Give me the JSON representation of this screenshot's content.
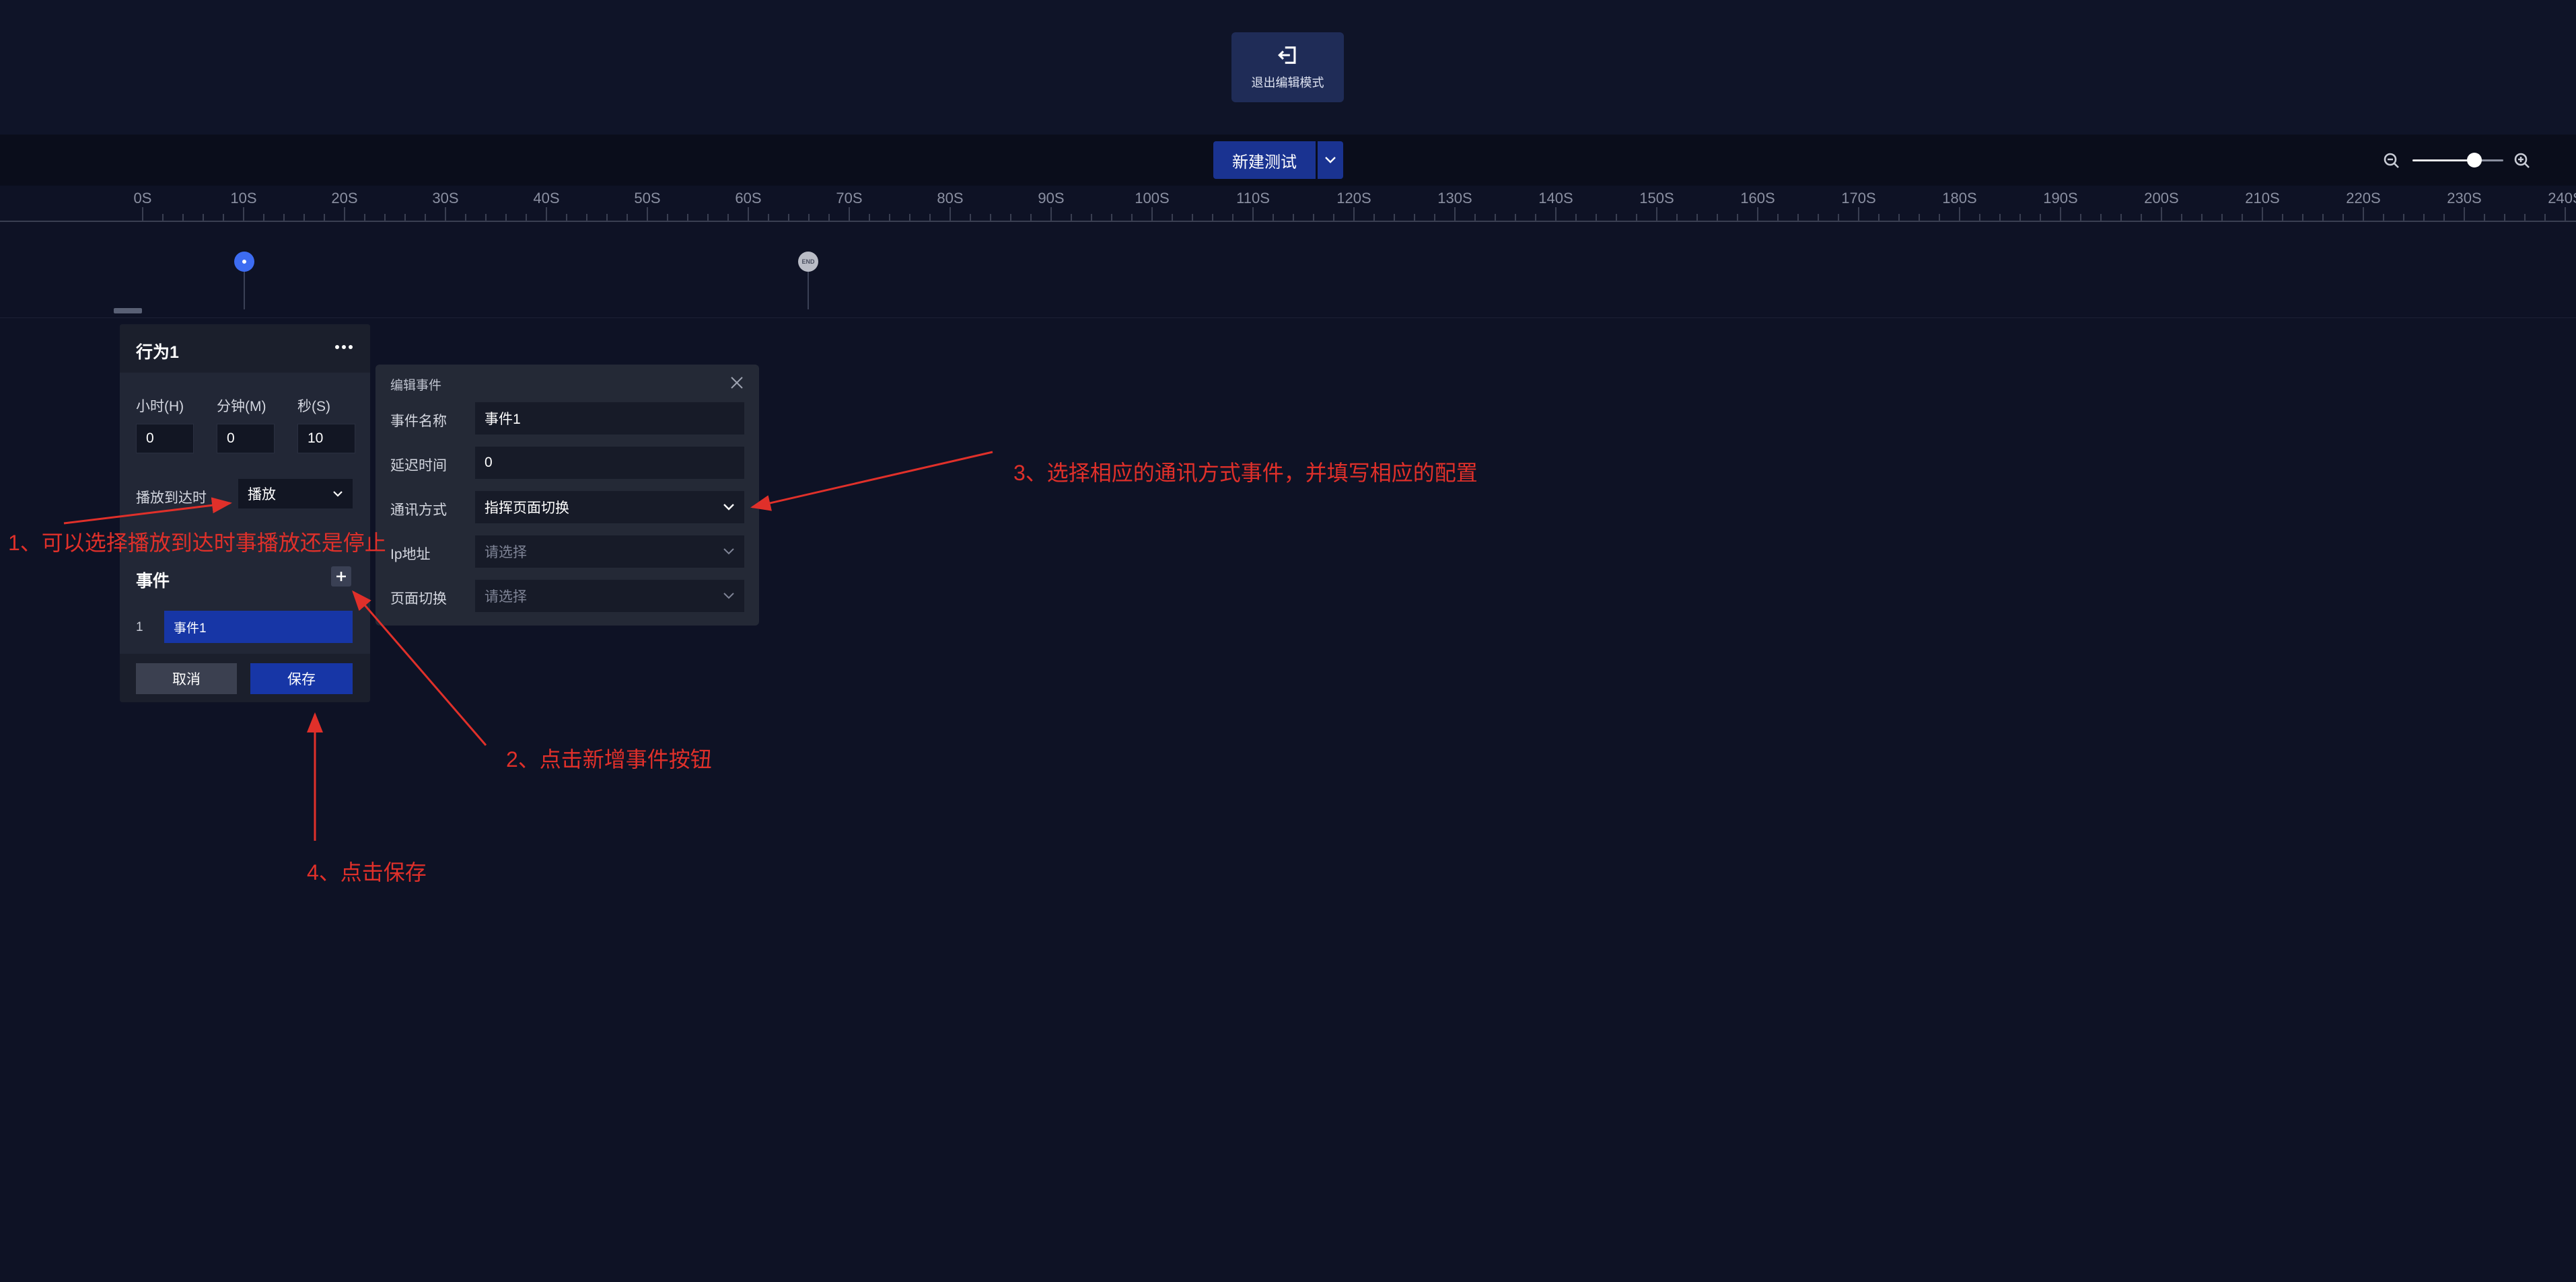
{
  "topbar": {
    "exit_label": "退出编辑模式"
  },
  "toolbar": {
    "new_test_label": "新建测试",
    "zoom_level": 0.68
  },
  "ruler": {
    "ticks": [
      "0S",
      "10S",
      "20S",
      "30S",
      "40S",
      "50S",
      "60S",
      "70S",
      "80S",
      "90S",
      "100S",
      "110S",
      "120S",
      "130S",
      "140S",
      "150S",
      "160S",
      "170S",
      "180S",
      "190S",
      "200S",
      "210S",
      "220S",
      "230S",
      "240S"
    ]
  },
  "track": {
    "end_label": "END"
  },
  "behavior_panel": {
    "title": "行为1",
    "hour_label": "小时(H)",
    "minute_label": "分钟(M)",
    "second_label": "秒(S)",
    "hour_value": "0",
    "minute_value": "0",
    "second_value": "10",
    "on_arrive_label": "播放到达时",
    "on_arrive_value": "播放",
    "events_title": "事件",
    "events": [
      {
        "index": "1",
        "name": "事件1"
      }
    ],
    "cancel_label": "取消",
    "save_label": "保存"
  },
  "edit_event": {
    "title": "编辑事件",
    "name_label": "事件名称",
    "name_value": "事件1",
    "delay_label": "延迟时间",
    "delay_value": "0",
    "comm_label": "通讯方式",
    "comm_value": "指挥页面切换",
    "ip_label": "Ip地址",
    "ip_placeholder": "请选择",
    "page_label": "页面切换",
    "page_placeholder": "请选择"
  },
  "annotations": {
    "step1": "1、可以选择播放到达时事播放还是停止",
    "step2": "2、点击新增事件按钮",
    "step3": "3、选择相应的通讯方式事件，并填写相应的配置",
    "step4": "4、点击保存"
  },
  "colors": {
    "background": "#0e1225",
    "accent": "#1736a6",
    "annotation": "#e0302a"
  }
}
